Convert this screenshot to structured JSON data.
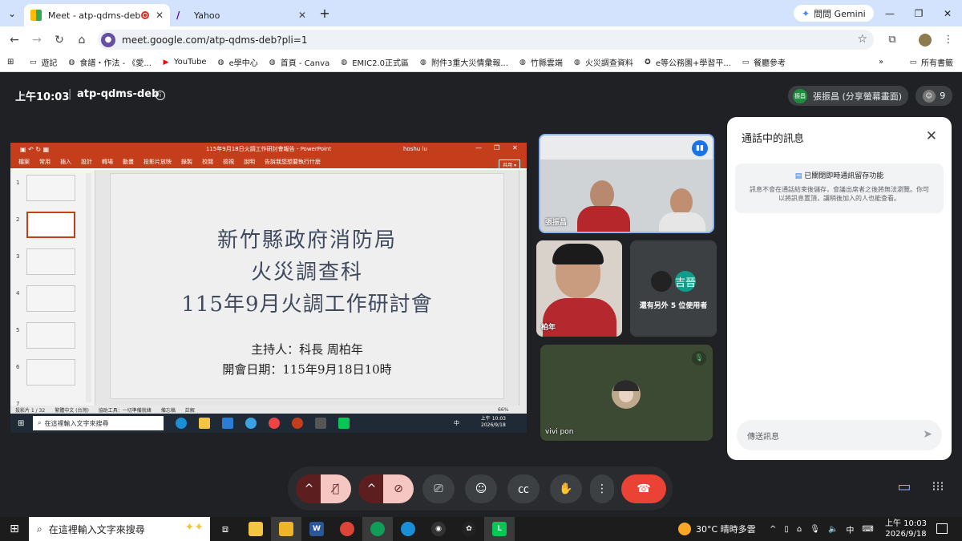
{
  "browser": {
    "tabs": [
      {
        "title": "Meet - atp-qdms-deb",
        "active": true
      },
      {
        "title": "Yahoo",
        "active": false
      }
    ],
    "gemini_label": "問問 Gemini",
    "url": "meet.google.com/atp-qdms-deb?pli=1",
    "bookmarks": [
      {
        "label": "遊記",
        "icon": "folder-icon"
      },
      {
        "label": "食譜・作法 - 《愛...",
        "icon": "globe-icon"
      },
      {
        "label": "YouTube",
        "icon": "youtube-icon"
      },
      {
        "label": "e學中心",
        "icon": "globe-icon"
      },
      {
        "label": "首頁 - Canva",
        "icon": "globe-icon"
      },
      {
        "label": "EMIC2.0正式區",
        "icon": "globe-icon"
      },
      {
        "label": "附件3重大災情彙報...",
        "icon": "globe-icon"
      },
      {
        "label": "竹縣雲端",
        "icon": "globe-icon"
      },
      {
        "label": "火災調查資料",
        "icon": "globe-icon"
      },
      {
        "label": "e等公務園+學習平...",
        "icon": "bulb-icon"
      },
      {
        "label": "餐廳參考",
        "icon": "folder-icon"
      }
    ],
    "all_bookmarks": "所有書籤",
    "overflow": "»"
  },
  "meet": {
    "time": "上午10:03",
    "separator": "|",
    "code": "atp-qdms-deb",
    "presenter_initials": "振昌",
    "presenter_label": "張振昌 (分享螢幕畫面)",
    "participant_count": "9",
    "tiles": [
      {
        "name": "張振昌"
      },
      {
        "name": "柏年"
      },
      {
        "more_avatar_label": "吉晉",
        "more_text": "還有另外 5 位使用者"
      },
      {
        "name": "vivi pon"
      }
    ]
  },
  "share": {
    "pp_title": "115年9月18日火調工作研討會報告 - PowerPoint",
    "pp_user": "hoshu lu",
    "ribbon": [
      "檔案",
      "常用",
      "插入",
      "設計",
      "轉場",
      "動畫",
      "投影片放映",
      "錄製",
      "校閱",
      "檢視",
      "說明",
      "告訴我您想要執行什麼"
    ],
    "share_btn": "共用",
    "thumb_numbers": [
      "1",
      "2",
      "3",
      "4",
      "5",
      "6",
      "7"
    ],
    "slide_lines": [
      "新竹縣政府消防局",
      "火災調查科",
      "115年9月火調工作研討會",
      "主持人：科長 周柏年",
      "開會日期：115年9月18日10時"
    ],
    "status": [
      "投影片 1 / 32",
      "繁體中文 (台灣)",
      "協助工具：一切準備就緒",
      "備忘稿",
      "註解",
      "66%"
    ],
    "task_search": "在這裡輸入文字來搜尋",
    "task_time": "上午 10:03",
    "task_date": "2026/9/18",
    "task_ime": "中"
  },
  "chat": {
    "title": "通話中的訊息",
    "note_heading": "已關閉即時通訊留存功能",
    "note_body": "訊息不會在通話結束後儲存，會議出席者之後將無法瀏覽。你可以將訊息置頂，讓稍後加入的人也能查看。",
    "input_placeholder": "傳送訊息"
  },
  "taskbar": {
    "search": "在這裡輸入文字來搜尋",
    "weather": "30°C 晴時多雲",
    "ime": "中",
    "time": "上午 10:03",
    "date": "2026/9/18"
  },
  "colors": {
    "accent_blue": "#8ab4f8",
    "end_call_red": "#ea4335",
    "ppt_red": "#c43e1c",
    "meet_bg": "#202124"
  }
}
